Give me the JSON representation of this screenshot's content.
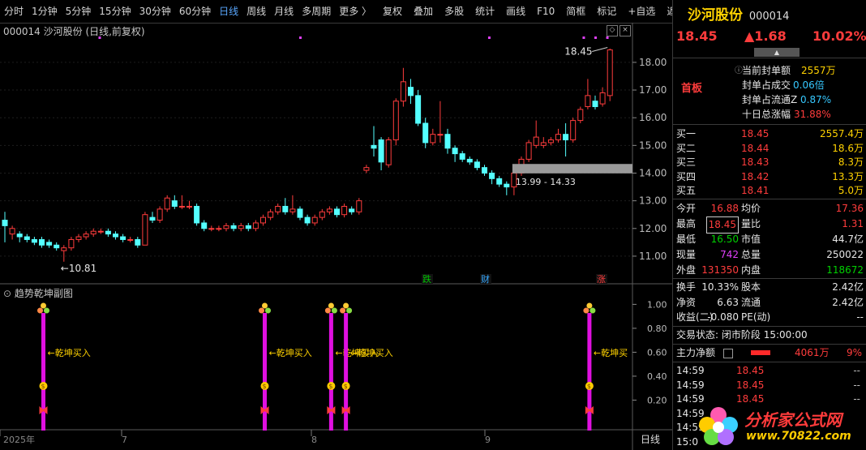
{
  "toolbar": {
    "items": [
      "分时",
      "1分钟",
      "5分钟",
      "15分钟",
      "30分钟",
      "60分钟",
      "日线",
      "周线",
      "月线",
      "多周期",
      "更多 〉"
    ],
    "active": "日线",
    "tools": [
      "复权",
      "叠加",
      "多股",
      "统计",
      "画线",
      "F10",
      "简框",
      "标记",
      "+自选",
      "返回"
    ]
  },
  "chart": {
    "title": "000014 沙河股份 (日线,前复权)",
    "price_axis": [
      "18.00",
      "17.00",
      "16.00",
      "15.00",
      "14.00",
      "13.00",
      "12.00",
      "11.00"
    ],
    "high_label": "18.45",
    "low_label": "10.81",
    "range_label": "13.99 - 14.33",
    "markers": [
      "跌",
      "财",
      "涨"
    ],
    "date_axis": [
      "2025年",
      "7",
      "8",
      "9"
    ],
    "period_label": "日线"
  },
  "indicator": {
    "title": "趋势乾坤副图",
    "axis": [
      "1.00",
      "0.80",
      "0.60",
      "0.40",
      "0.20"
    ],
    "signal_label": "乾坤买入",
    "signals": [
      {
        "day": 5,
        "label": "←乾坤买入"
      },
      {
        "day": 35,
        "label": "←乾坤买入"
      },
      {
        "day": 44,
        "label": "←乾坤买入"
      },
      {
        "day": 46,
        "label": "←乾坤买入"
      },
      {
        "day": 79,
        "label": "←乾坤买"
      }
    ]
  },
  "chart_data": {
    "type": "candlestick",
    "ylim": [
      10.5,
      18.7
    ],
    "candles": [
      [
        12.3,
        12.1,
        12.6,
        11.5
      ],
      [
        11.8,
        12.0,
        12.1,
        11.6
      ],
      [
        11.8,
        11.7,
        11.9,
        11.5
      ],
      [
        11.7,
        11.6,
        11.8,
        11.5
      ],
      [
        11.6,
        11.5,
        11.7,
        11.4
      ],
      [
        11.6,
        11.4,
        11.7,
        11.3
      ],
      [
        11.5,
        11.4,
        11.6,
        11.3
      ],
      [
        11.4,
        11.3,
        11.5,
        11.2
      ],
      [
        11.2,
        11.3,
        11.4,
        10.8
      ],
      [
        11.3,
        11.6,
        11.7,
        11.2
      ],
      [
        11.6,
        11.7,
        11.8,
        11.5
      ],
      [
        11.7,
        11.8,
        11.9,
        11.6
      ],
      [
        11.8,
        11.9,
        12.0,
        11.7
      ],
      [
        11.9,
        11.9,
        12.0,
        11.8
      ],
      [
        11.9,
        11.8,
        12.0,
        11.7
      ],
      [
        11.8,
        11.7,
        11.9,
        11.6
      ],
      [
        11.7,
        11.6,
        11.8,
        11.5
      ],
      [
        11.6,
        11.6,
        11.7,
        11.5
      ],
      [
        11.6,
        11.4,
        11.7,
        11.3
      ],
      [
        11.4,
        12.5,
        12.6,
        11.4
      ],
      [
        12.4,
        12.3,
        12.6,
        12.2
      ],
      [
        12.3,
        12.7,
        12.8,
        12.2
      ],
      [
        12.7,
        13.1,
        13.2,
        12.6
      ],
      [
        13.0,
        12.8,
        13.2,
        12.7
      ],
      [
        12.8,
        12.8,
        13.2,
        12.7
      ],
      [
        12.8,
        12.8,
        13.0,
        12.7
      ],
      [
        12.8,
        12.2,
        12.9,
        12.1
      ],
      [
        12.2,
        12.0,
        12.3,
        11.9
      ],
      [
        12.0,
        12.0,
        12.1,
        11.9
      ],
      [
        12.0,
        12.0,
        12.1,
        11.9
      ],
      [
        12.0,
        12.1,
        12.2,
        11.9
      ],
      [
        12.1,
        12.0,
        12.2,
        11.9
      ],
      [
        12.0,
        12.1,
        12.2,
        11.9
      ],
      [
        12.1,
        12.0,
        12.2,
        11.9
      ],
      [
        12.0,
        12.2,
        12.3,
        11.9
      ],
      [
        12.2,
        12.4,
        12.5,
        12.1
      ],
      [
        12.4,
        12.6,
        12.7,
        12.3
      ],
      [
        12.6,
        12.8,
        12.9,
        12.5
      ],
      [
        12.8,
        12.6,
        13.1,
        12.5
      ],
      [
        12.6,
        12.7,
        13.2,
        12.5
      ],
      [
        12.7,
        12.4,
        12.8,
        12.3
      ],
      [
        12.4,
        12.2,
        12.5,
        12.1
      ],
      [
        12.2,
        12.4,
        12.5,
        12.1
      ],
      [
        12.4,
        12.6,
        12.7,
        12.3
      ],
      [
        12.6,
        12.7,
        12.8,
        12.5
      ],
      [
        12.7,
        12.5,
        12.8,
        12.4
      ],
      [
        12.5,
        12.8,
        12.9,
        12.4
      ],
      [
        12.7,
        12.6,
        12.8,
        12.5
      ],
      [
        12.6,
        13.0,
        13.1,
        12.5
      ],
      [
        14.1,
        14.2,
        14.3,
        14.0
      ],
      [
        15.0,
        14.9,
        15.7,
        14.6
      ],
      [
        15.2,
        14.4,
        15.3,
        14.1
      ],
      [
        14.3,
        15.2,
        15.3,
        14.2
      ],
      [
        15.2,
        16.6,
        16.7,
        15.0
      ],
      [
        16.6,
        17.3,
        17.8,
        16.4
      ],
      [
        17.1,
        16.8,
        17.4,
        16.5
      ],
      [
        16.8,
        15.8,
        17.0,
        15.7
      ],
      [
        15.8,
        15.1,
        16.0,
        14.9
      ],
      [
        15.1,
        15.4,
        15.6,
        15.0
      ],
      [
        15.4,
        15.4,
        16.6,
        15.1
      ],
      [
        15.4,
        14.9,
        15.6,
        14.7
      ],
      [
        14.9,
        14.7,
        15.0,
        14.4
      ],
      [
        14.7,
        14.5,
        14.8,
        14.4
      ],
      [
        14.5,
        14.4,
        14.6,
        14.3
      ],
      [
        14.4,
        14.2,
        14.5,
        14.1
      ],
      [
        14.2,
        14.0,
        14.3,
        13.9
      ],
      [
        14.0,
        13.8,
        14.1,
        13.6
      ],
      [
        13.8,
        13.6,
        13.9,
        13.5
      ],
      [
        13.6,
        13.5,
        13.7,
        13.2
      ],
      [
        13.5,
        14.0,
        14.1,
        13.2
      ],
      [
        14.0,
        14.5,
        14.6,
        13.9
      ],
      [
        14.5,
        15.1,
        15.2,
        14.4
      ],
      [
        15.0,
        15.3,
        15.9,
        14.9
      ],
      [
        15.0,
        15.1,
        15.3,
        14.9
      ],
      [
        15.1,
        15.2,
        15.3,
        15.0
      ],
      [
        15.2,
        15.4,
        15.6,
        15.1
      ],
      [
        15.4,
        15.2,
        15.8,
        14.6
      ],
      [
        15.2,
        15.9,
        16.0,
        15.1
      ],
      [
        15.9,
        16.3,
        16.4,
        15.8
      ],
      [
        16.4,
        16.8,
        17.4,
        16.3
      ],
      [
        16.6,
        16.4,
        16.8,
        16.3
      ],
      [
        16.5,
        16.9,
        17.1,
        16.4
      ],
      [
        16.8,
        18.45,
        18.5,
        16.6
      ]
    ]
  },
  "quote": {
    "name": "沙河股份",
    "code": "000014",
    "price": "18.45",
    "change": "▲1.68",
    "pct": "10.02%",
    "tag": "首板",
    "seal_amount_label": "当前封单额",
    "seal_amount": "2557万",
    "seal_trade_label": "封单占成交",
    "seal_trade": "0.06倍",
    "seal_float_label": "封单占流通Z",
    "seal_float": "0.87%",
    "ten_day_label": "十日总涨幅",
    "ten_day": "31.88%",
    "bids": [
      {
        "label": "买一",
        "price": "18.45",
        "vol": "2557.4万"
      },
      {
        "label": "买二",
        "price": "18.44",
        "vol": "18.6万"
      },
      {
        "label": "买三",
        "price": "18.43",
        "vol": "8.3万"
      },
      {
        "label": "买四",
        "price": "18.42",
        "vol": "13.3万"
      },
      {
        "label": "买五",
        "price": "18.41",
        "vol": "5.0万"
      }
    ],
    "stats": [
      {
        "l1": "今开",
        "v1": "16.88",
        "l2": "均价",
        "v2": "17.36"
      },
      {
        "l1": "最高",
        "v1": "18.45",
        "l2": "量比",
        "v2": "1.31"
      },
      {
        "l1": "最低",
        "v1": "16.50",
        "l2": "市值",
        "v2": "44.7亿"
      },
      {
        "l1": "现量",
        "v1": "742",
        "l2": "总量",
        "v2": "250022"
      },
      {
        "l1": "外盘",
        "v1": "131350",
        "l2": "内盘",
        "v2": "118672"
      }
    ],
    "stats2": [
      {
        "l1": "换手",
        "v1": "10.33%",
        "l2": "股本",
        "v2": "2.42亿"
      },
      {
        "l1": "净资",
        "v1": "6.63",
        "l2": "流通",
        "v2": "2.42亿"
      },
      {
        "l1": "收益(二)",
        "v1": "-0.080",
        "l2": "PE(动)",
        "v2": "--"
      }
    ],
    "trade_state_label": "交易状态:",
    "trade_state": "闭市阶段 15:00:00",
    "net_label": "主力净额",
    "net_value": "4061万",
    "net_pct": "9%",
    "ticks": [
      {
        "time": "14:59",
        "price": "18.45",
        "vol": "--"
      },
      {
        "time": "14:59",
        "price": "18.45",
        "vol": "--"
      },
      {
        "time": "14:59",
        "price": "18.45",
        "vol": "--"
      },
      {
        "time": "14:59",
        "price": "",
        "vol": ""
      },
      {
        "time": "14:59",
        "price": "",
        "vol": ""
      },
      {
        "time": "15:0",
        "price": "",
        "vol": ""
      }
    ],
    "watermark_name": "分析家公式网",
    "watermark_url": "www.70822.com"
  }
}
